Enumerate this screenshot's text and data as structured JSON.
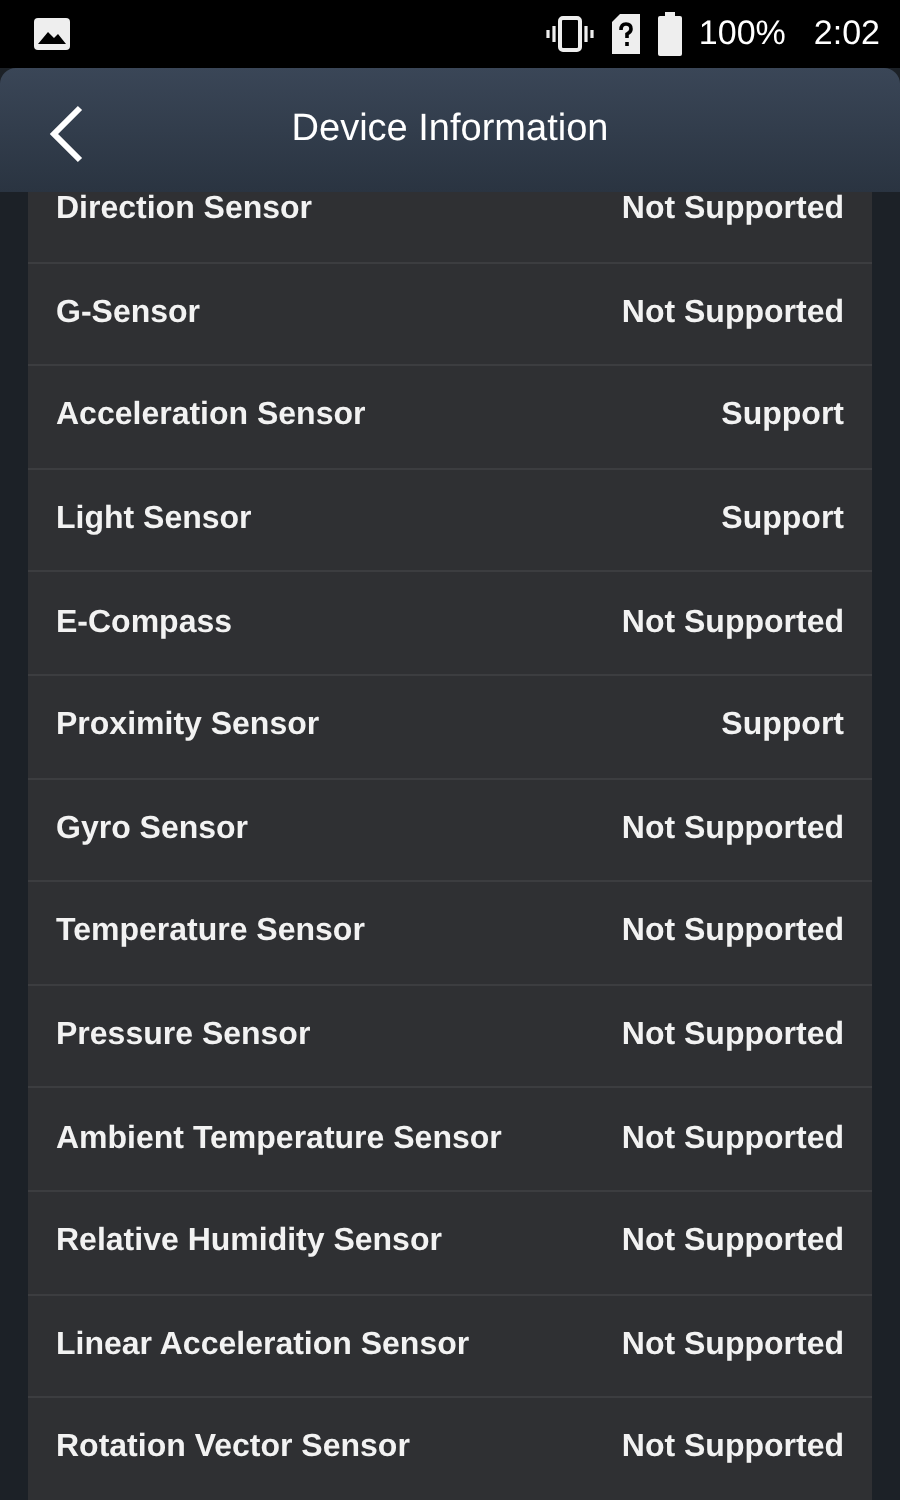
{
  "status_bar": {
    "battery": "100%",
    "time": "2:02"
  },
  "header": {
    "title": "Device Information"
  },
  "sensors": [
    {
      "name": "Direction Sensor",
      "value": "Not Supported"
    },
    {
      "name": "G-Sensor",
      "value": "Not Supported"
    },
    {
      "name": "Acceleration Sensor",
      "value": "Support"
    },
    {
      "name": "Light Sensor",
      "value": "Support"
    },
    {
      "name": "E-Compass",
      "value": "Not Supported"
    },
    {
      "name": "Proximity Sensor",
      "value": "Support"
    },
    {
      "name": "Gyro Sensor",
      "value": "Not Supported"
    },
    {
      "name": "Temperature Sensor",
      "value": "Not Supported"
    },
    {
      "name": "Pressure Sensor",
      "value": "Not Supported"
    },
    {
      "name": "Ambient Temperature Sensor",
      "value": "Not Supported"
    },
    {
      "name": "Relative Humidity Sensor",
      "value": "Not Supported"
    },
    {
      "name": "Linear Acceleration Sensor",
      "value": "Not Supported"
    },
    {
      "name": "Rotation Vector Sensor",
      "value": "Not Supported"
    }
  ]
}
